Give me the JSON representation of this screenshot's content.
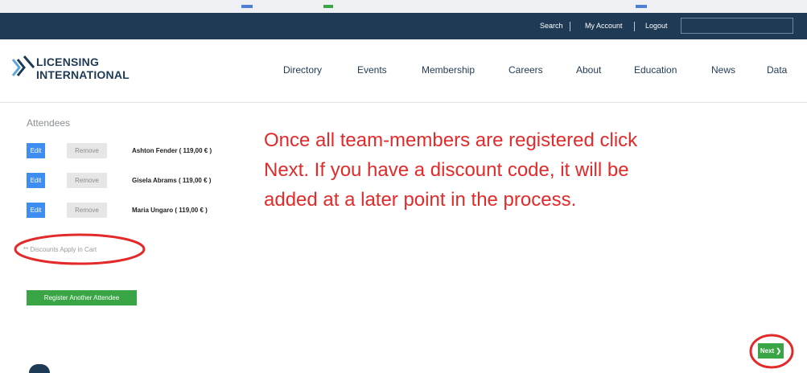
{
  "topbar": {
    "search_label": "Search",
    "account_label": "My Account",
    "logout_label": "Logout"
  },
  "logo": {
    "line1": "LICENSING",
    "line2": "INTERNATIONAL"
  },
  "nav": {
    "items": [
      {
        "label": "Directory"
      },
      {
        "label": "Events"
      },
      {
        "label": "Membership"
      },
      {
        "label": "Careers"
      },
      {
        "label": "About"
      },
      {
        "label": "Education"
      },
      {
        "label": "News"
      },
      {
        "label": "Data"
      }
    ]
  },
  "attendees": {
    "title": "Attendees",
    "edit_label": "Edit",
    "remove_label": "Remove",
    "rows": [
      {
        "name": "Ashton Fender ( 119,00 € )"
      },
      {
        "name": "Gisela Abrams ( 119,00 € )"
      },
      {
        "name": "Maria Ungaro ( 119,00 € )"
      }
    ],
    "discount_note": "** Discounts Apply in Cart",
    "register_label": "Register Another Attendee"
  },
  "instruction": {
    "line1": "Once all team-members are registered click",
    "line2": "Next. If you have a discount code, it will be",
    "line3": "added at a later point in the process."
  },
  "next_label": "Next ❯",
  "colors": {
    "brand_navy": "#1f3a55",
    "annotation_red": "#e22a2a",
    "edit_blue": "#3d8ef0",
    "action_green": "#3aa544"
  }
}
